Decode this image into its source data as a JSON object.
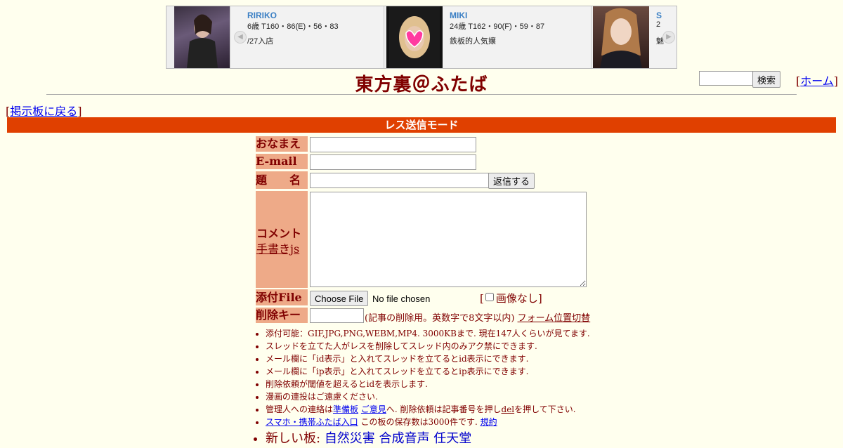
{
  "banner": {
    "cards": [
      {
        "name": "RIRIKO",
        "spec": "6歳 T160・86(E)・56・83",
        "note": "/27入店"
      },
      {
        "name": "MIKI",
        "spec": "24歳 T162・90(F)・59・87",
        "note": "鉄板的人気嬢"
      },
      {
        "name": "S",
        "spec": "2",
        "note": "魅"
      }
    ],
    "prev_arrow": "◀",
    "next_arrow": "▶"
  },
  "site": {
    "title": "東方裏＠ふたば",
    "search_button": "検索",
    "home_link": "ホーム",
    "back_link": "掲示板に戻る",
    "mode_bar": "レス送信モード"
  },
  "form": {
    "name_label": "おなまえ",
    "email_label": "E-mail",
    "subject_label": "題　　名",
    "submit_button": "返信する",
    "comment_label": "コメント",
    "handwrite_link": "手書きjs",
    "file_label": "添付File",
    "choose_file_button": "Choose File",
    "no_file_text": "No file chosen",
    "no_image_label": "画像なし",
    "delkey_label": "削除キー",
    "delkey_note": "(記事の削除用。英数字で8文字以内)",
    "form_position_link": "フォーム位置切替"
  },
  "notes": {
    "n1": "添付可能：GIF,JPG,PNG,WEBM,MP4. 3000KBまで. 現在147人くらいが見てます.",
    "n2": "スレッドを立てた人がレスを削除してスレッド内のみアク禁にできます.",
    "n3": "メール欄に「id表示」と入れてスレッドを立てるとid表示にできます.",
    "n4": "メール欄に「ip表示」と入れてスレッドを立てるとip表示にできます.",
    "n5": "削除依頼が閾値を超えるとidを表示します.",
    "n6": "漫画の連投はご遠慮ください.",
    "n7_pre": "管理人への連絡は",
    "n7_link1": "準備板",
    "n7_link2": "ご意見",
    "n7_mid": "へ. 削除依頼は記事番号を押し",
    "n7_link3": "del",
    "n7_post": "を押して下さい.",
    "n8_link": "スマホ・携帯ふたば入口",
    "n8_mid": "この板の保存数は3000件です.",
    "n8_link2": "規約",
    "n9_pre": "新しい板:",
    "n9_links": [
      "自然災害",
      "合成音声",
      "任天堂"
    ]
  }
}
